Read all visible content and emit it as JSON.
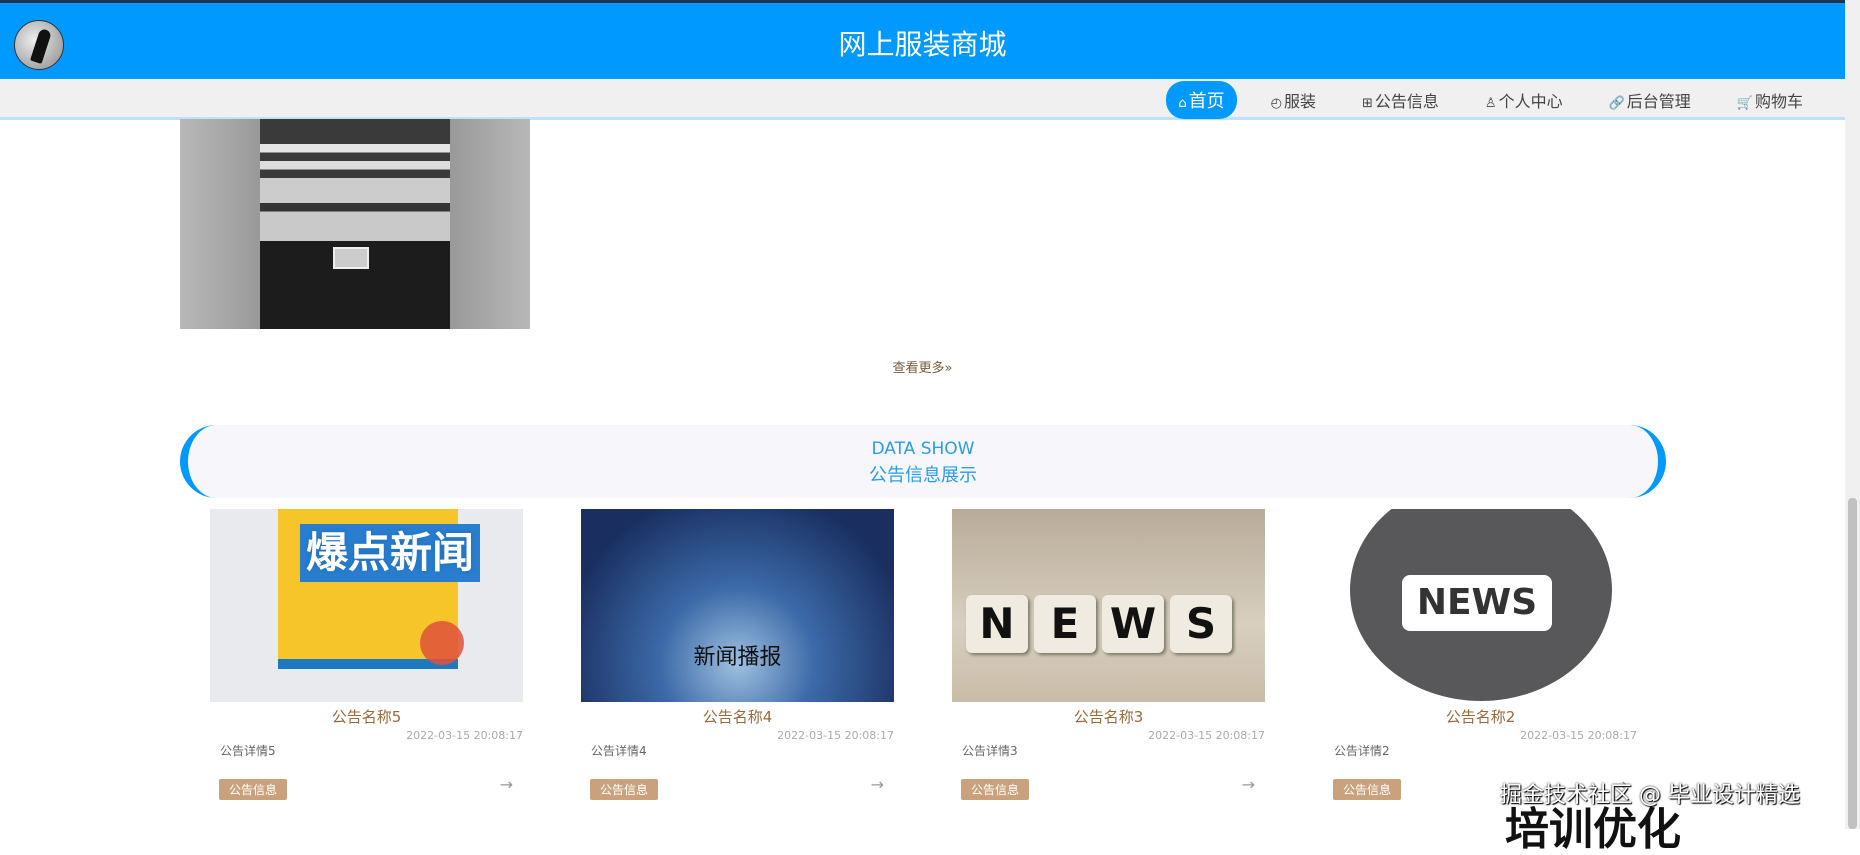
{
  "header": {
    "title": "网上服装商城"
  },
  "nav": {
    "items": [
      {
        "icon": "⌂",
        "label": "首页"
      },
      {
        "icon": "◴",
        "label": "服装"
      },
      {
        "icon": "⊞",
        "label": "公告信息"
      },
      {
        "icon": "♙",
        "label": "个人中心"
      },
      {
        "icon": "🔗",
        "label": "后台管理"
      },
      {
        "icon": "🛒",
        "label": "购物车"
      }
    ]
  },
  "products": {
    "more_label": "查看更多»"
  },
  "notices": {
    "banner_en": "DATA SHOW",
    "banner_cn": "公告信息展示",
    "items": [
      {
        "name": "公告名称5",
        "date": "2022-03-15 20:08:17",
        "detail": "公告详情5",
        "tag": "公告信息",
        "image_text": "爆点新闻"
      },
      {
        "name": "公告名称4",
        "date": "2022-03-15 20:08:17",
        "detail": "公告详情4",
        "tag": "公告信息",
        "image_text": "新闻播报"
      },
      {
        "name": "公告名称3",
        "date": "2022-03-15 20:08:17",
        "detail": "公告详情3",
        "tag": "公告信息",
        "image_text": "NEWS"
      },
      {
        "name": "公告名称2",
        "date": "2022-03-15 20:08:17",
        "detail": "公告详情2",
        "tag": "公告信息",
        "image_text": "NEWS"
      }
    ],
    "arrow": "→"
  },
  "overlay": {
    "watermark": "掘金技术社区 @ 毕业设计精选",
    "caption": "培训优化"
  }
}
